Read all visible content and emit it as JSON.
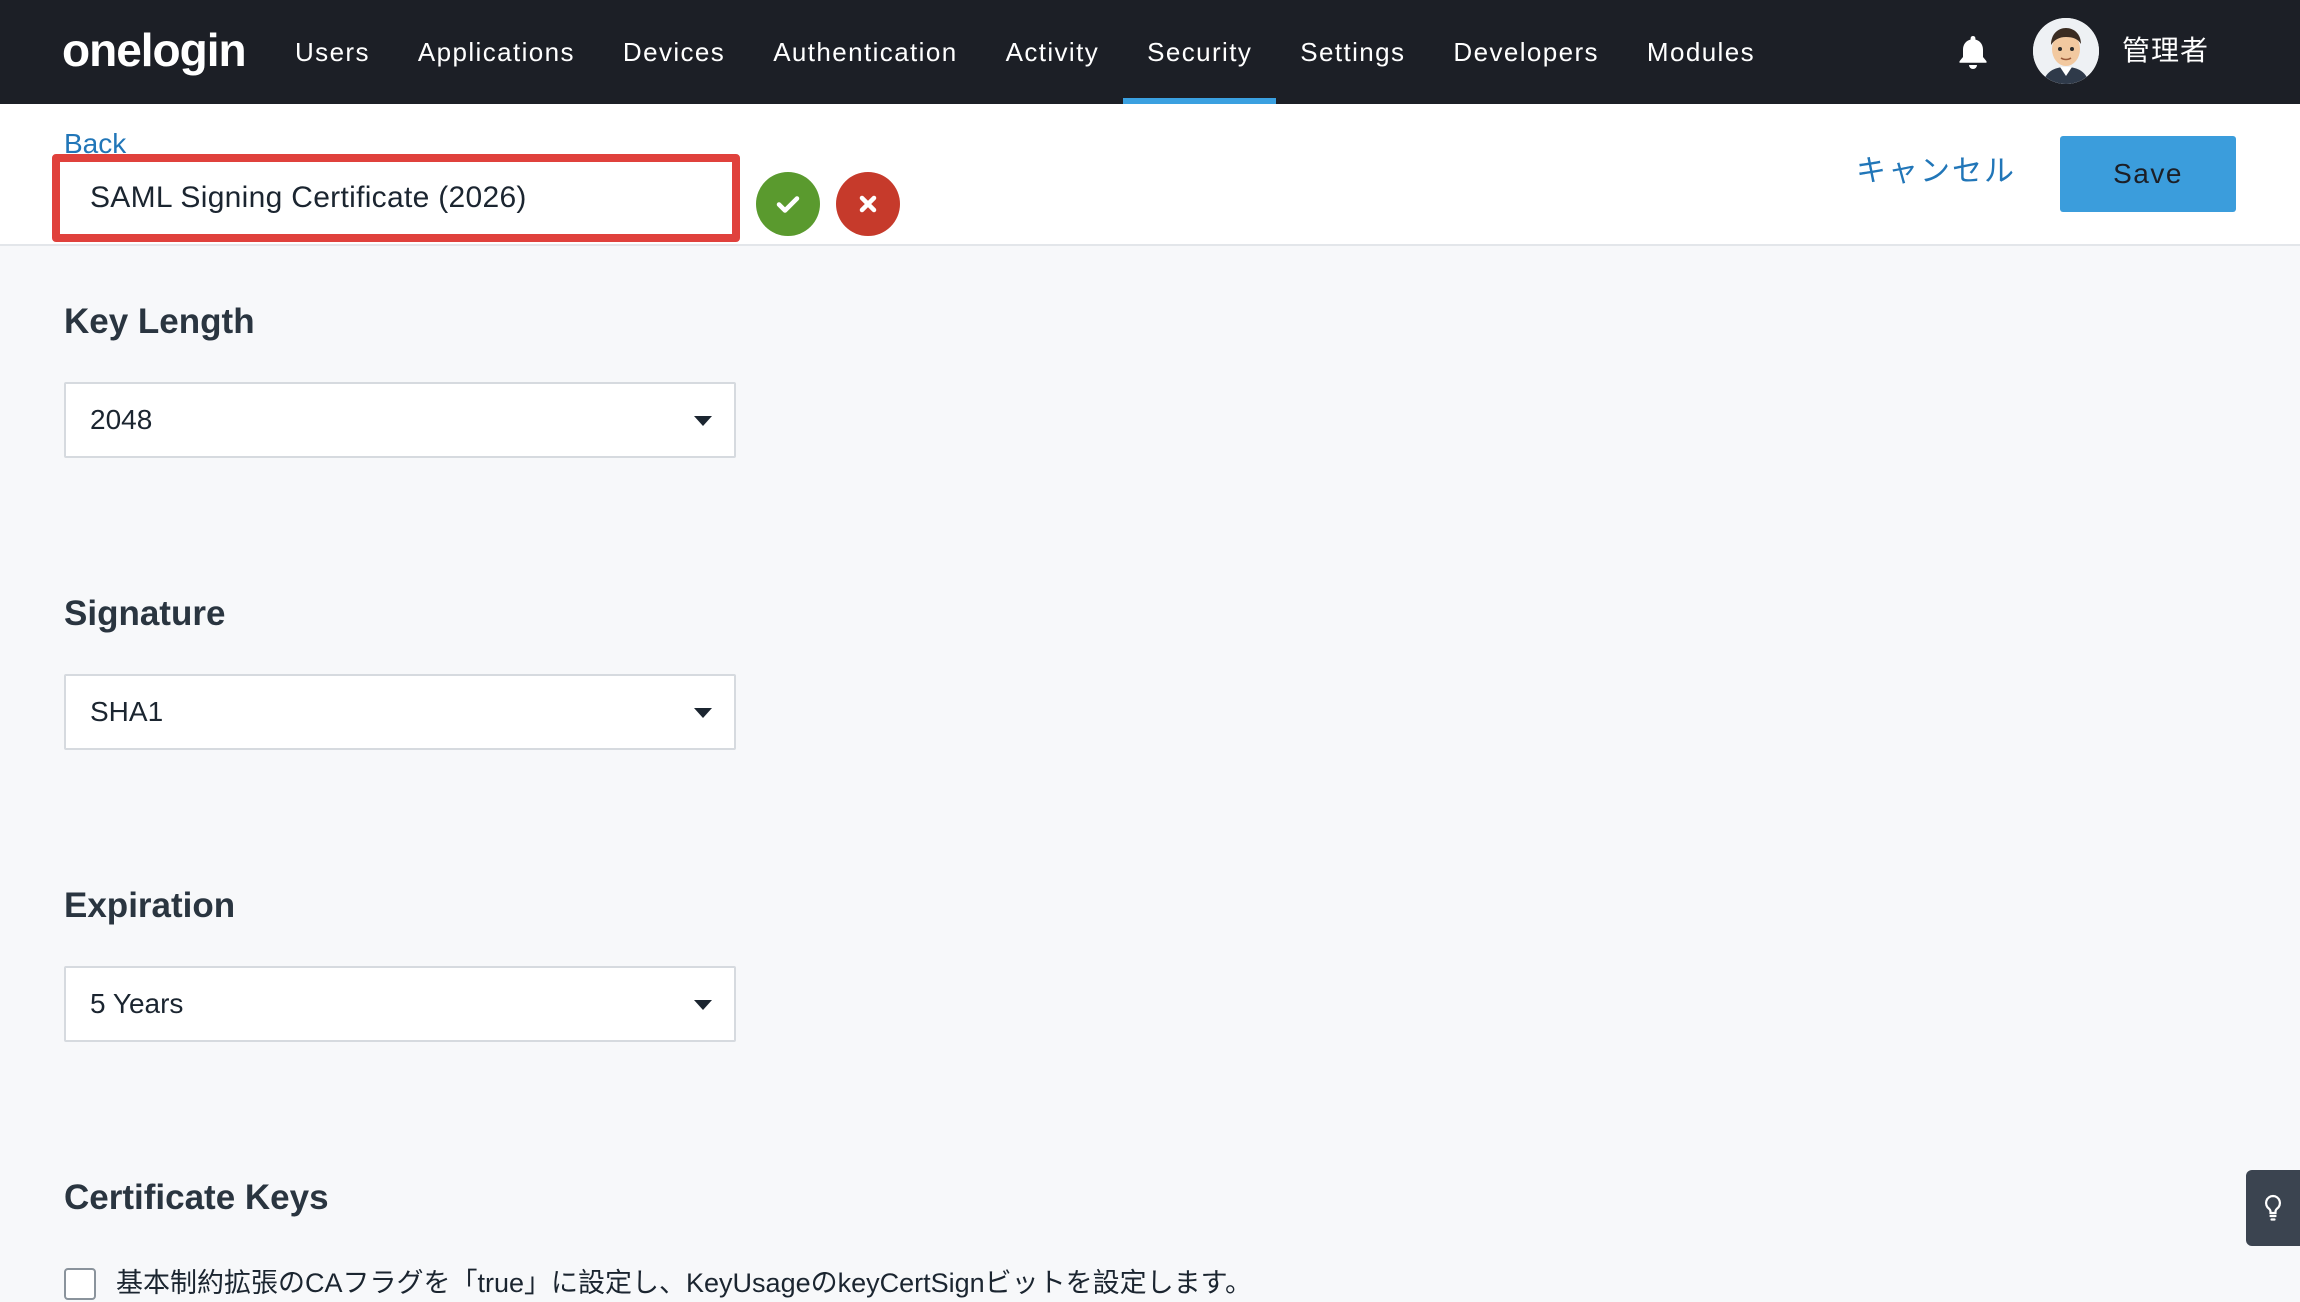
{
  "brand": {
    "logo_text": "onelogin"
  },
  "nav": {
    "items": [
      {
        "label": "Users",
        "active": false
      },
      {
        "label": "Applications",
        "active": false
      },
      {
        "label": "Devices",
        "active": false
      },
      {
        "label": "Authentication",
        "active": false
      },
      {
        "label": "Activity",
        "active": false
      },
      {
        "label": "Security",
        "active": true
      },
      {
        "label": "Settings",
        "active": false
      },
      {
        "label": "Developers",
        "active": false
      },
      {
        "label": "Modules",
        "active": false
      }
    ],
    "notifications_icon": "bell-icon",
    "user": {
      "avatar_icon": "user-avatar",
      "name": "管理者"
    }
  },
  "header": {
    "back_label": "Back",
    "certificate_name": "SAML Signing Certificate (2026)",
    "confirm_icon": "check-icon",
    "discard_icon": "close-icon",
    "cancel_label": "キャンセル",
    "save_label": "Save"
  },
  "form": {
    "key_length": {
      "title": "Key Length",
      "value": "2048"
    },
    "signature": {
      "title": "Signature",
      "value": "SHA1"
    },
    "expiration": {
      "title": "Expiration",
      "value": "5 Years"
    },
    "certificate_keys": {
      "title": "Certificate Keys",
      "ca_flag_checked": false,
      "ca_flag_label": "基本制約拡張のCAフラグを「true」に設定し、KeyUsageのkeyCertSignビットを設定します。"
    }
  },
  "help": {
    "icon": "lightbulb-icon"
  },
  "colors": {
    "nav_bg": "#1c1f26",
    "accent_blue": "#3b9ddc",
    "link_blue": "#2176b8",
    "confirm_green": "#5a9a2e",
    "discard_red": "#c63a2b",
    "highlight_red": "#e0413c"
  }
}
